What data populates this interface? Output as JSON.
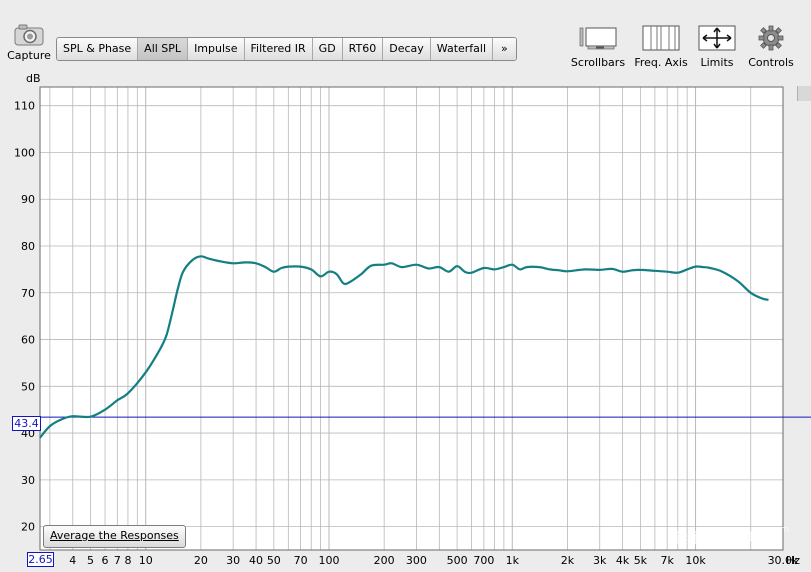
{
  "toolbar": {
    "capture_label": "Capture",
    "tabs": [
      {
        "label": "SPL & Phase",
        "active": false
      },
      {
        "label": "All SPL",
        "active": true
      },
      {
        "label": "Impulse",
        "active": false
      },
      {
        "label": "Filtered IR",
        "active": false
      },
      {
        "label": "GD",
        "active": false
      },
      {
        "label": "RT60",
        "active": false
      },
      {
        "label": "Decay",
        "active": false
      },
      {
        "label": "Waterfall",
        "active": false
      },
      {
        "label": "»",
        "active": false
      }
    ],
    "tools": {
      "scrollbars_label": "Scrollbars",
      "freq_axis_label": "Freq. Axis",
      "limits_label": "Limits",
      "controls_label": "Controls"
    }
  },
  "colors": {
    "trace": "#147f83",
    "cursor": "#1515c0",
    "grid": "#b8b8b8",
    "plot_bg": "#ffffff"
  },
  "plot": {
    "y_unit_label": "dB",
    "x_unit_label": "Hz",
    "cursor_y_readout": "43.4",
    "x_min_readout": "2.65",
    "average_button_label": "Average the Responses",
    "watermark": "音频技术视听",
    "watermark_small": "com"
  },
  "chart_data": {
    "type": "line",
    "xscale": "log",
    "xlim": [
      2.65,
      30000
    ],
    "ylim": [
      15,
      114
    ],
    "ylabel": "dB",
    "xlabel": "Hz",
    "yticks": [
      20,
      30,
      40,
      50,
      60,
      70,
      80,
      90,
      100,
      110
    ],
    "xticks": [
      {
        "v": 4,
        "label": "4"
      },
      {
        "v": 5,
        "label": "5"
      },
      {
        "v": 6,
        "label": "6"
      },
      {
        "v": 7,
        "label": "7"
      },
      {
        "v": 8,
        "label": "8"
      },
      {
        "v": 10,
        "label": "10"
      },
      {
        "v": 20,
        "label": "20"
      },
      {
        "v": 30,
        "label": "30"
      },
      {
        "v": 40,
        "label": "40"
      },
      {
        "v": 50,
        "label": "50"
      },
      {
        "v": 70,
        "label": "70"
      },
      {
        "v": 100,
        "label": "100"
      },
      {
        "v": 200,
        "label": "200"
      },
      {
        "v": 300,
        "label": "300"
      },
      {
        "v": 500,
        "label": "500"
      },
      {
        "v": 700,
        "label": "700"
      },
      {
        "v": 1000,
        "label": "1k"
      },
      {
        "v": 2000,
        "label": "2k"
      },
      {
        "v": 3000,
        "label": "3k"
      },
      {
        "v": 4000,
        "label": "4k"
      },
      {
        "v": 5000,
        "label": "5k"
      },
      {
        "v": 7000,
        "label": "7k"
      },
      {
        "v": 10000,
        "label": "10k"
      },
      {
        "v": 30000,
        "label": "30.0k"
      }
    ],
    "cursor_y": 43.4,
    "series": [
      {
        "x": [
          2.65,
          3,
          3.5,
          4,
          5,
          6,
          7,
          8,
          10,
          12,
          13,
          14,
          15,
          16,
          18,
          20,
          22,
          25,
          30,
          35,
          40,
          45,
          50,
          55,
          60,
          70,
          80,
          90,
          100,
          110,
          120,
          130,
          150,
          170,
          200,
          220,
          250,
          300,
          350,
          400,
          450,
          500,
          550,
          600,
          700,
          800,
          900,
          1000,
          1100,
          1200,
          1400,
          1600,
          1800,
          2000,
          2500,
          3000,
          3500,
          4000,
          4500,
          5000,
          6000,
          7000,
          8000,
          9000,
          10000,
          11000,
          12000,
          14000,
          17000,
          20000,
          23000,
          25000
        ],
        "y": [
          39,
          41.5,
          43,
          43.6,
          43.5,
          45,
          47,
          48.5,
          53,
          58,
          61,
          66,
          71,
          74.5,
          77,
          77.8,
          77.3,
          76.8,
          76.3,
          76.5,
          76.3,
          75.5,
          74.5,
          75.3,
          75.6,
          75.6,
          75,
          73.5,
          74.5,
          74,
          72,
          72.3,
          74,
          75.8,
          76,
          76.3,
          75.5,
          76,
          75.2,
          75.5,
          74.5,
          75.7,
          74.5,
          74.3,
          75.3,
          75,
          75.5,
          76,
          75,
          75.5,
          75.5,
          75,
          74.8,
          74.6,
          75,
          74.9,
          75.1,
          74.5,
          74.8,
          74.9,
          74.7,
          74.5,
          74.3,
          75,
          75.6,
          75.5,
          75.3,
          74.5,
          72.5,
          70,
          68.8,
          68.5
        ]
      }
    ]
  }
}
